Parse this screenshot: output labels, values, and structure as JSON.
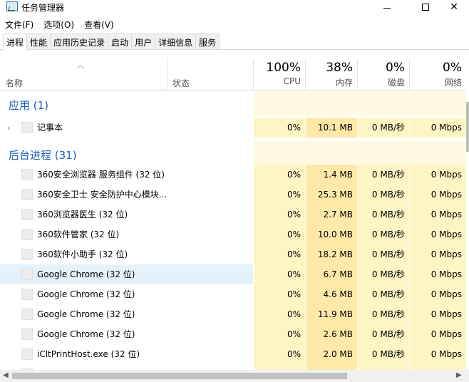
{
  "window": {
    "title": "任务管理器"
  },
  "menu": [
    "文件(F)",
    "选项(O)",
    "查看(V)"
  ],
  "tabs": [
    "进程",
    "性能",
    "应用历史记录",
    "启动",
    "用户",
    "详细信息",
    "服务"
  ],
  "header": {
    "name": "名称",
    "status": "状态",
    "cpu": {
      "pct": "100%",
      "label": "CPU"
    },
    "mem": {
      "pct": "38%",
      "label": "内存"
    },
    "disk": {
      "pct": "0%",
      "label": "磁盘"
    },
    "net": {
      "pct": "0%",
      "label": "网络"
    }
  },
  "groups": {
    "apps": "应用 (1)",
    "background": "后台进程 (31)"
  },
  "processes": [
    {
      "name": "记事本",
      "cpu": "0%",
      "mem": "10.1 MB",
      "disk": "0 MB/秒",
      "net": "0 Mbps"
    },
    {
      "name": "360安全浏览器 服务组件 (32 位)",
      "cpu": "0%",
      "mem": "1.4 MB",
      "disk": "0 MB/秒",
      "net": "0 Mbps"
    },
    {
      "name": "360安全卫士 安全防护中心模块...",
      "cpu": "0%",
      "mem": "25.3 MB",
      "disk": "0 MB/秒",
      "net": "0 Mbps"
    },
    {
      "name": "360浏览器医生 (32 位)",
      "cpu": "0%",
      "mem": "2.7 MB",
      "disk": "0 MB/秒",
      "net": "0 Mbps"
    },
    {
      "name": "360软件管家 (32 位)",
      "cpu": "0%",
      "mem": "10.0 MB",
      "disk": "0 MB/秒",
      "net": "0 Mbps"
    },
    {
      "name": "360软件小助手 (32 位)",
      "cpu": "0%",
      "mem": "18.2 MB",
      "disk": "0 MB/秒",
      "net": "0 Mbps"
    },
    {
      "name": "Google Chrome (32 位)",
      "cpu": "0%",
      "mem": "6.7 MB",
      "disk": "0 MB/秒",
      "net": "0 Mbps"
    },
    {
      "name": "Google Chrome (32 位)",
      "cpu": "0%",
      "mem": "4.6 MB",
      "disk": "0 MB/秒",
      "net": "0 Mbps"
    },
    {
      "name": "Google Chrome (32 位)",
      "cpu": "0%",
      "mem": "11.9 MB",
      "disk": "0 MB/秒",
      "net": "0 Mbps"
    },
    {
      "name": "Google Chrome (32 位)",
      "cpu": "0%",
      "mem": "2.6 MB",
      "disk": "0 MB/秒",
      "net": "0 Mbps"
    },
    {
      "name": "iCltPrintHost.exe (32 位)",
      "cpu": "0%",
      "mem": "2.0 MB",
      "disk": "0 MB/秒",
      "net": "0 Mbps"
    }
  ]
}
